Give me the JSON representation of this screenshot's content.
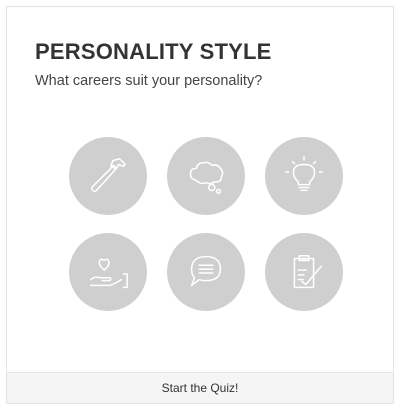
{
  "card": {
    "title": "PERSONALITY STYLE",
    "subtitle": "What careers suit your personality?",
    "icons": [
      {
        "name": "hammer-icon"
      },
      {
        "name": "thought-bubble-icon"
      },
      {
        "name": "lightbulb-icon"
      },
      {
        "name": "hand-heart-icon"
      },
      {
        "name": "speech-bubble-icon"
      },
      {
        "name": "clipboard-check-icon"
      }
    ],
    "circle_color": "#cfcfcf",
    "icon_stroke_color": "#ffffff",
    "start_button_label": "Start the Quiz!"
  }
}
